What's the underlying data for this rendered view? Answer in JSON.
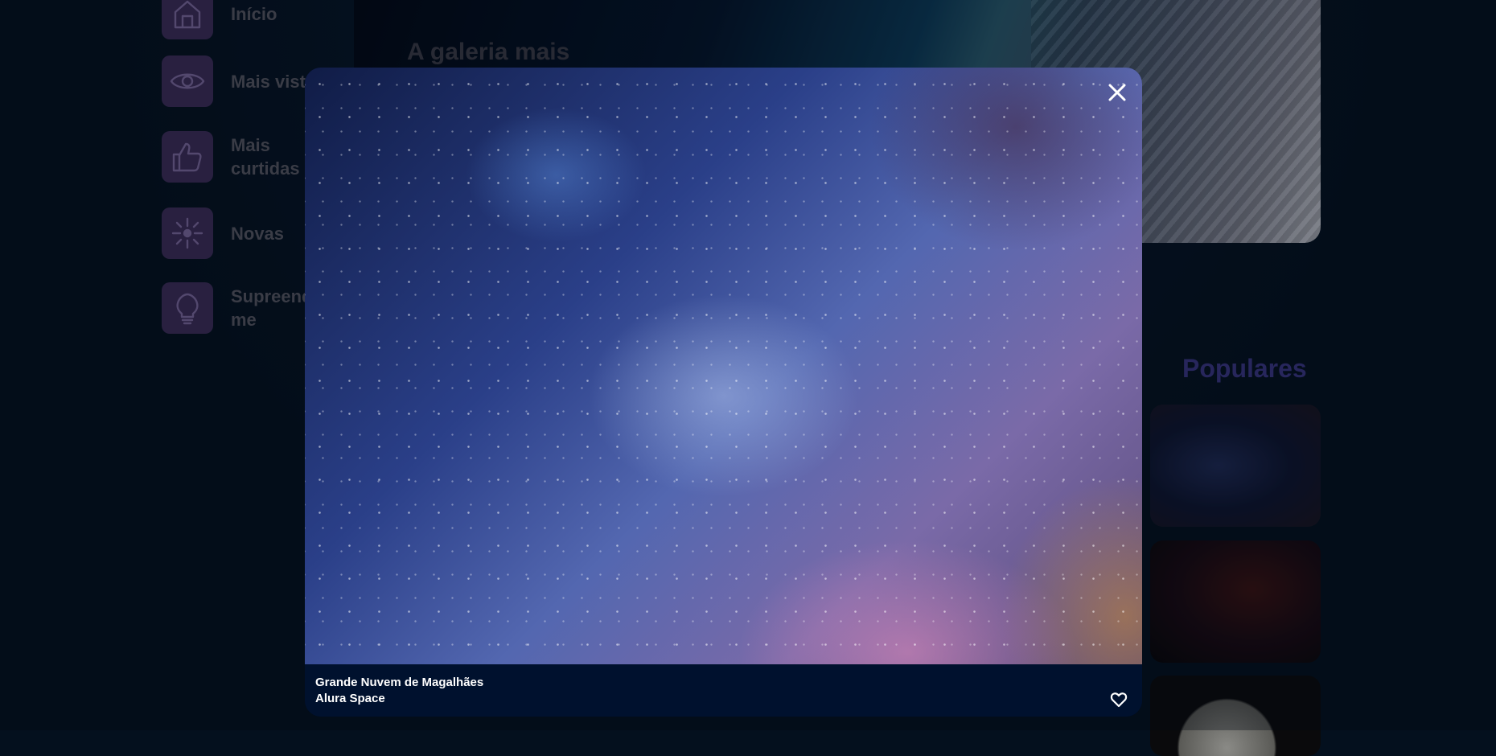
{
  "sidebar": {
    "items": [
      {
        "label": "Início",
        "icon": "home-icon"
      },
      {
        "label": "Mais vist",
        "icon": "eye-icon"
      },
      {
        "label": "Mais\ncurtidas",
        "icon": "thumbs-up-icon"
      },
      {
        "label": "Novas",
        "icon": "sparkle-icon"
      },
      {
        "label": "Supreend\nme",
        "icon": "lightbulb-icon"
      }
    ]
  },
  "banner": {
    "title": "A galeria mais"
  },
  "popular": {
    "title": "Populares"
  },
  "modal": {
    "caption_title": "Grande Nuvem de Magalhães",
    "caption_source": "Alura Space",
    "close_icon": "close-icon",
    "favorite_icon": "heart-icon"
  },
  "colors": {
    "background": "#04101e",
    "nav_icon_bg": "#3e2d5a",
    "accent_title": "#3b3784",
    "modal_footer": "#00112e"
  }
}
